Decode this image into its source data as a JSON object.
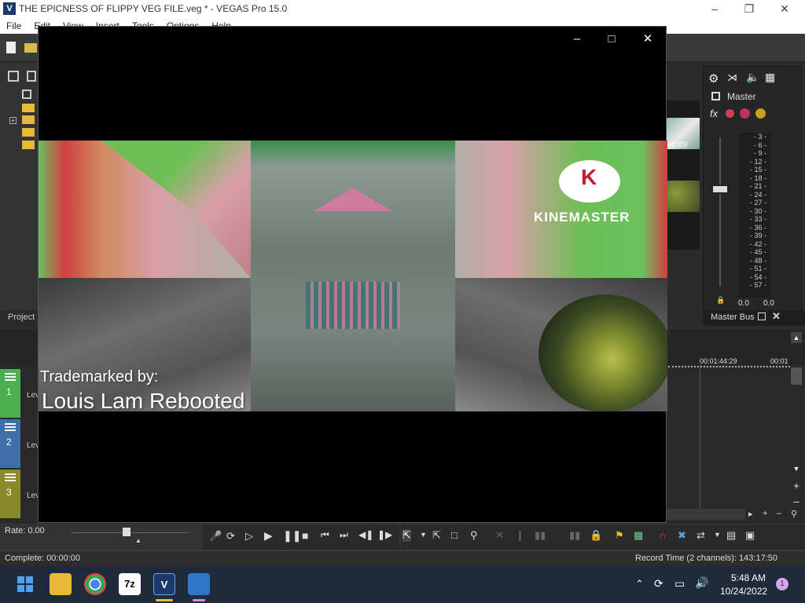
{
  "window": {
    "title": "THE EPICNESS OF FLIPPY VEG FILE.veg * - VEGAS Pro 15.0",
    "app_icon_letter": "V"
  },
  "menu": [
    "File",
    "Edit",
    "View",
    "Insert",
    "Tools",
    "Options",
    "Help"
  ],
  "left_panel": {
    "tab_label": "Project"
  },
  "master": {
    "label": "Master",
    "bus_label": "Master Bus",
    "meter_scale": [
      "3",
      "6",
      "9",
      "12",
      "15",
      "18",
      "21",
      "24",
      "27",
      "30",
      "33",
      "36",
      "39",
      "42",
      "45",
      "48",
      "51",
      "54",
      "57"
    ],
    "left_value": "0.0",
    "right_value": "0.0"
  },
  "timeline": {
    "ruler_label_1": "00:01:44:29",
    "ruler_label_2": "00:01",
    "tracks": [
      {
        "number": "1",
        "label": "Lev",
        "color": "#4caf50"
      },
      {
        "number": "2",
        "label": "Lev",
        "color": "#3f6fa8"
      },
      {
        "number": "3",
        "label": "Lev",
        "color": "#8a8a2c"
      }
    ]
  },
  "transport": {
    "rate_label": "Rate: 0.00"
  },
  "status": {
    "complete": "Complete: 00:00:00",
    "record_time": "Record Time (2 channels): 143:17:50"
  },
  "taskbar": {
    "time": "5:48 AM",
    "date": "10/24/2022",
    "notification_count": "1",
    "zip_label": "7z",
    "vegas_label": "V"
  },
  "preview": {
    "watermark": "KINEMASTER",
    "caption_line1": "Trademarked by:",
    "caption_line2": "Louis Lam Rebooted",
    "thumb_label": "ASTER"
  }
}
